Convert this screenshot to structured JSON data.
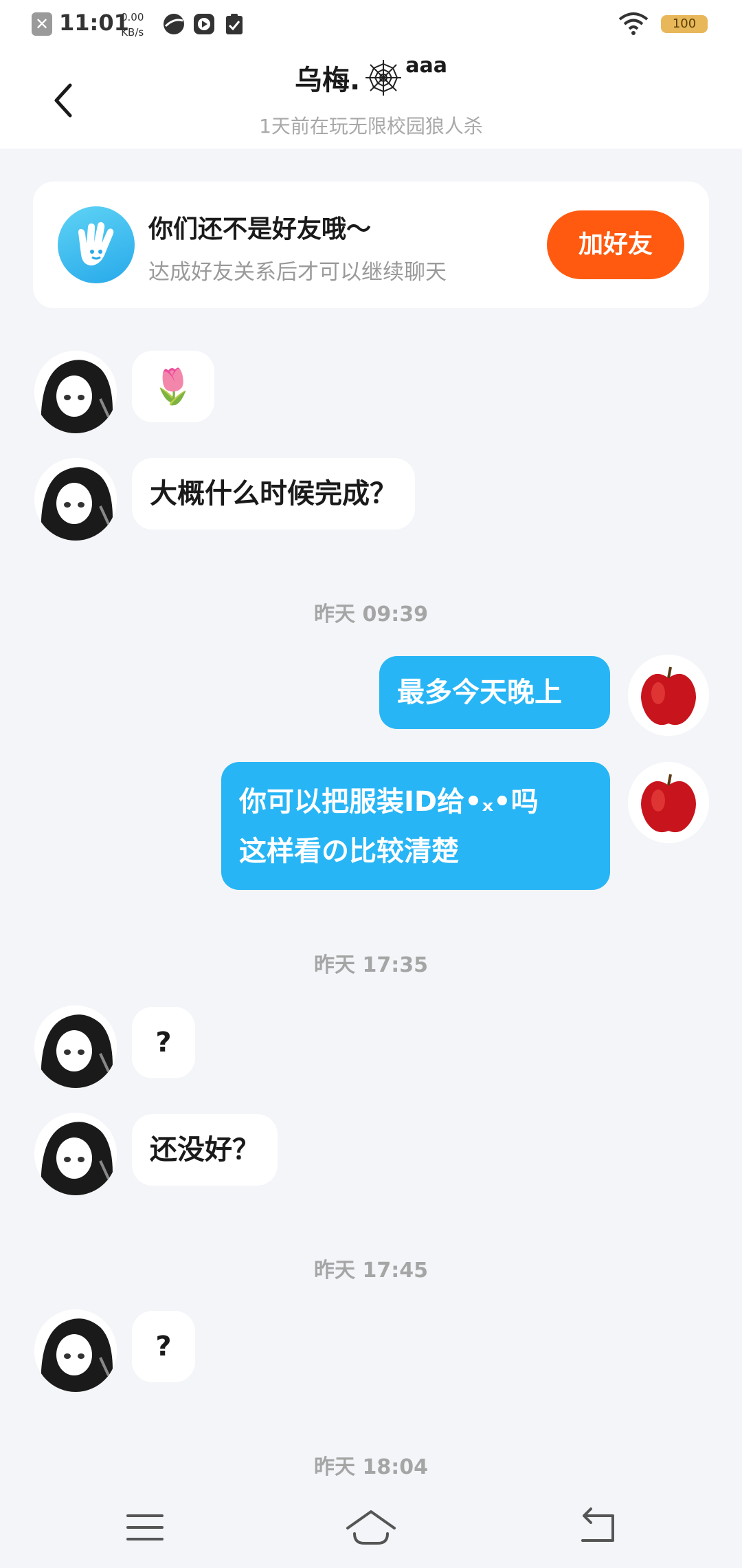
{
  "status_bar": {
    "time": "11:01",
    "speed_value": "0.00",
    "speed_unit": "KB/s",
    "battery": "100"
  },
  "header": {
    "title": "乌梅.",
    "title_suffix": "aaa",
    "subtitle": "1天前在玩无限校园狼人杀"
  },
  "friend_card": {
    "title": "你们还不是好友哦～",
    "subtitle": "达成好友关系后才可以继续聊天",
    "button_label": "加好友"
  },
  "messages": {
    "m1": "🌷",
    "m2": "大概什么时候完成？",
    "ts1": "昨天  09:39",
    "m3": "最多今天晚上",
    "m4_line1": "你可以把服装ID给•ₓ•吗",
    "m4_line2": "这样看の比较清楚",
    "ts2": "昨天  17:35",
    "m5": "?",
    "m6": "还没好？",
    "ts3": "昨天  17:45",
    "m7": "?",
    "ts4": "昨天  18:04"
  },
  "colors": {
    "accent_blue": "#27b5f5",
    "add_friend_orange": "#ff5a10",
    "background": "#f3f5f8"
  }
}
